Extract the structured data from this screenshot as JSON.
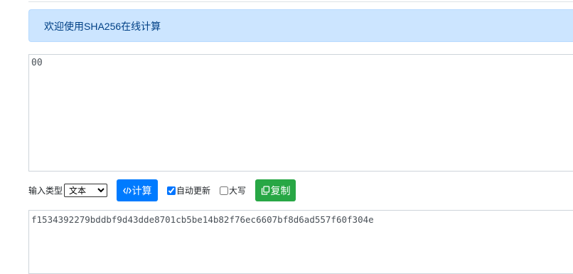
{
  "alert": {
    "message": "欢迎使用SHA256在线计算"
  },
  "input": {
    "value": "00"
  },
  "controls": {
    "type_label": "输入类型",
    "type_selected": "文本",
    "type_options": [
      "文本"
    ],
    "compute_label": "计算",
    "auto_update_label": "自动更新",
    "auto_update_checked": true,
    "uppercase_label": "大写",
    "uppercase_checked": false,
    "copy_label": "复制"
  },
  "output": {
    "value": "f1534392279bddbf9d43dde8701cb5be14b82f76ec6607bf8d6ad557f60f304e"
  },
  "icons": {
    "compute": "code-icon",
    "copy": "copy-icon"
  },
  "colors": {
    "alert_bg": "#cce5ff",
    "alert_text": "#004085",
    "primary": "#007bff",
    "success": "#28a745"
  }
}
